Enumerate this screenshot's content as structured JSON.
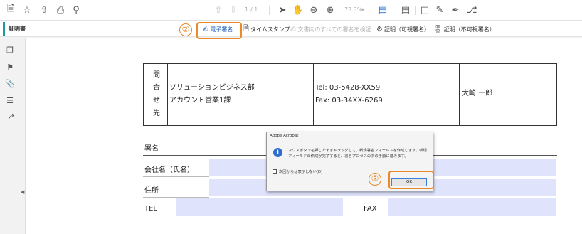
{
  "toolbar": {
    "page_current": "1",
    "page_total": "/ 1",
    "zoom": "73.3%"
  },
  "tools": {
    "title": "証明書",
    "items": [
      {
        "label": "電子署名",
        "state": "highlight"
      },
      {
        "label": "タイムスタンプ",
        "state": "normal"
      },
      {
        "label": "文書内のすべての署名を検証",
        "state": "dim"
      },
      {
        "label": "証明（可視署名）",
        "state": "normal"
      },
      {
        "label": "証明（不可視署名）",
        "state": "normal"
      }
    ]
  },
  "callouts": {
    "step2": "②",
    "step3": "③"
  },
  "contact_table": {
    "label_chars": [
      "問",
      "合",
      "せ",
      "先"
    ],
    "dept_line1": "ソリューションビジネス部",
    "dept_line2": "アカウント営業1課",
    "tel": "Tel: 03-5428-XX59",
    "fax": "Fax: 03-34XX-6269",
    "person": "大崎 一郎"
  },
  "signature_form": {
    "title": "署名",
    "company_label": "会社名（氏名）",
    "address_label": "住所",
    "tel_label": "TEL",
    "fax_label": "FAX"
  },
  "dialog": {
    "title": "Adobe Acrobat",
    "message": "マウスボタンを押したままドラッグして、新規署名フィールドを作成します。新規フィールドの作成が完了すると、署名プロセスの次の手順に進みます。",
    "checkbox_label": "次回からは表示しない(D)",
    "ok_label": "OK"
  }
}
